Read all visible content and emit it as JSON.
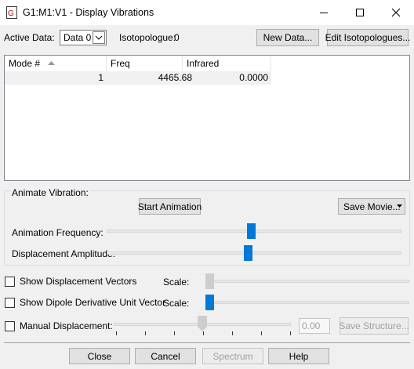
{
  "window": {
    "title": "G1:M1:V1 - Display Vibrations",
    "minimize_glyph": "—",
    "maximize_glyph": "☐",
    "close_glyph": "✕"
  },
  "toolbar": {
    "active_data_label": "Active Data:",
    "active_data_value": "Data 0",
    "isotopologue_label": "Isotopologue:",
    "isotopologue_value": "0",
    "new_data_button": "New Data...",
    "edit_isotopologues_button": "Edit Isotopologues..."
  },
  "table": {
    "columns": [
      "Mode #",
      "Freq",
      "Infrared"
    ],
    "sort_column": "Mode #",
    "sort_direction": "ascending",
    "rows": [
      {
        "mode": "1",
        "freq": "4465.68",
        "infrared": "0.0000"
      }
    ]
  },
  "animate": {
    "group_label": "Animate Vibration:",
    "start_button": "Start Animation",
    "save_movie_button": "Save Movie...",
    "frequency_label": "Animation Frequency:",
    "frequency_level": 0.49,
    "amplitude_label": "Displacement Amplitude:",
    "amplitude_level": 0.48
  },
  "options": {
    "show_displacement_vectors": {
      "label": "Show Displacement Vectors",
      "checked": false,
      "scale_label": "Scale:",
      "scale_level": 0.0
    },
    "show_dipole_vector": {
      "label": "Show Dipole Derivative Unit Vector",
      "checked": false,
      "scale_label": "Scale:",
      "scale_level": 0.0
    },
    "manual_displacement": {
      "label": "Manual Displacement:",
      "checked": false,
      "value": "0.00",
      "level": 0.5
    },
    "save_structure_button": "Save Structure..."
  },
  "footer": {
    "close_button": "Close",
    "cancel_button": "Cancel",
    "spectrum_button": "Spectrum",
    "help_button": "Help"
  },
  "colors": {
    "accent": "#0078d7",
    "dialog_background": "#f0f0f0",
    "disabled_text": "#a0a0a0"
  }
}
